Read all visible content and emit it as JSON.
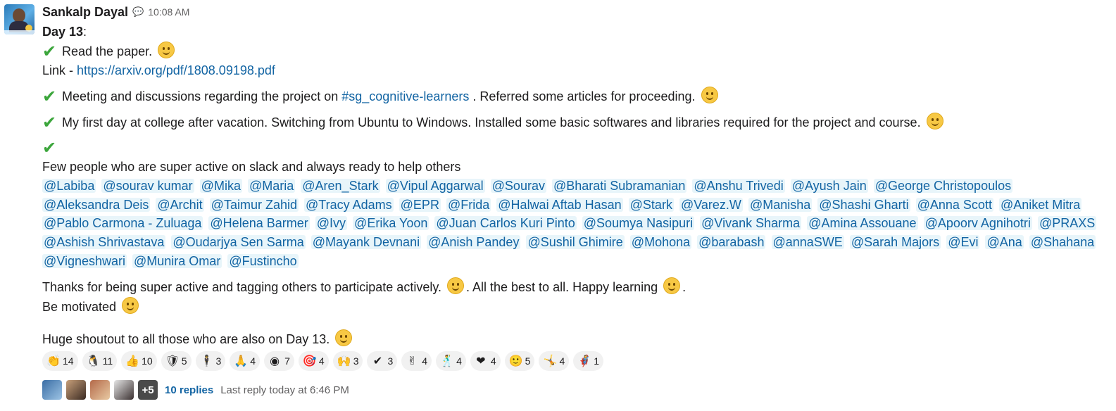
{
  "message": {
    "author": "Sankalp Dayal",
    "time": "10:08 AM",
    "day_title": "Day 13",
    "colon": ":",
    "items": {
      "read_paper": "Read the paper.",
      "link_prefix": "Link - ",
      "link_url": "https://arxiv.org/pdf/1808.09198.pdf",
      "meeting_pre": "Meeting and discussions regarding the project on ",
      "channel": "#sg_cognitive-learners",
      "meeting_post": " . Referred some articles for proceeding.",
      "college": "My first day at college after vacation. Switching from Ubuntu to Windows. Installed some basic softwares and libraries required for the project and course.",
      "few_people": "Few people who are super active on slack and always ready to help others"
    },
    "mentions": [
      "@Labiba",
      "@sourav kumar",
      "@Mika",
      "@Maria",
      "@Aren_Stark",
      "@Vipul Aggarwal",
      "@Sourav",
      "@Bharati Subramanian",
      "@Anshu Trivedi",
      "@Ayush Jain",
      "@George Christopoulos",
      "@Aleksandra Deis",
      "@Archit",
      "@Taimur Zahid",
      "@Tracy Adams",
      "@EPR",
      "@Frida",
      "@Halwai Aftab Hasan",
      "@Stark",
      "@Varez.W",
      "@Manisha",
      "@Shashi Gharti",
      "@Anna Scott",
      "@Aniket Mitra",
      "@Pablo Carmona - Zuluaga",
      "@Helena Barmer",
      "@Ivy",
      "@Erika Yoon",
      "@Juan Carlos Kuri Pinto",
      "@Soumya Nasipuri",
      "@Vivank Sharma",
      "@Amina Assouane",
      "@Apoorv Agnihotri",
      "@PRAXS",
      "@Ashish Shrivastava",
      "@Oudarjya Sen Sarma",
      "@Mayank Devnani",
      "@Anish Pandey",
      "@Sushil Ghimire",
      "@Mohona",
      "@barabash",
      "@annaSWE",
      "@Sarah Majors",
      "@Evi",
      "@Ana",
      "@Shahana",
      "@Vigneshwari",
      "@Munira Omar",
      "@Fustincho"
    ],
    "thanks_1": "Thanks for being super active and tagging others to participate actively. ",
    "thanks_2": ". All the best to all. Happy learning ",
    "thanks_3": ".",
    "motivated": "Be motivated",
    "shoutout": "Huge shoutout to all those who are also on Day 13."
  },
  "reactions": [
    {
      "icon": "clap-icon",
      "glyph": "👏",
      "count": "14"
    },
    {
      "icon": "penguin-icon",
      "glyph": "🐧",
      "count": "11"
    },
    {
      "icon": "thumbs-up-icon",
      "glyph": "👍",
      "count": "10"
    },
    {
      "icon": "shield-badge-icon",
      "glyph": "🛡",
      "count": "5"
    },
    {
      "icon": "person-icon",
      "glyph": "🕴",
      "count": "3"
    },
    {
      "icon": "thank-you-icon",
      "glyph": "🙏",
      "count": "4"
    },
    {
      "icon": "bullseye-icon",
      "glyph": "◉",
      "count": "7"
    },
    {
      "icon": "target-icon",
      "glyph": "🎯",
      "count": "4"
    },
    {
      "icon": "raised-hands-icon",
      "glyph": "🙌",
      "count": "3"
    },
    {
      "icon": "check-icon",
      "glyph": "✔",
      "count": "3"
    },
    {
      "icon": "victory-hand-icon",
      "glyph": "✌",
      "count": "4"
    },
    {
      "icon": "dance-icon",
      "glyph": "🕺",
      "count": "4"
    },
    {
      "icon": "heart-icon",
      "glyph": "❤",
      "count": "4"
    },
    {
      "icon": "smiley-icon",
      "glyph": "🙂",
      "count": "5"
    },
    {
      "icon": "celebrate-icon",
      "glyph": "🤸",
      "count": "4"
    },
    {
      "icon": "superhero-icon",
      "glyph": "🦸",
      "count": "1"
    }
  ],
  "thread": {
    "more_count": "+5",
    "replies": "10 replies",
    "last_reply": "Last reply today at 6:46 PM"
  },
  "colors": {
    "link": "#1264a3",
    "mention_bg": "#e8f5fa",
    "check": "#3ca63c"
  }
}
